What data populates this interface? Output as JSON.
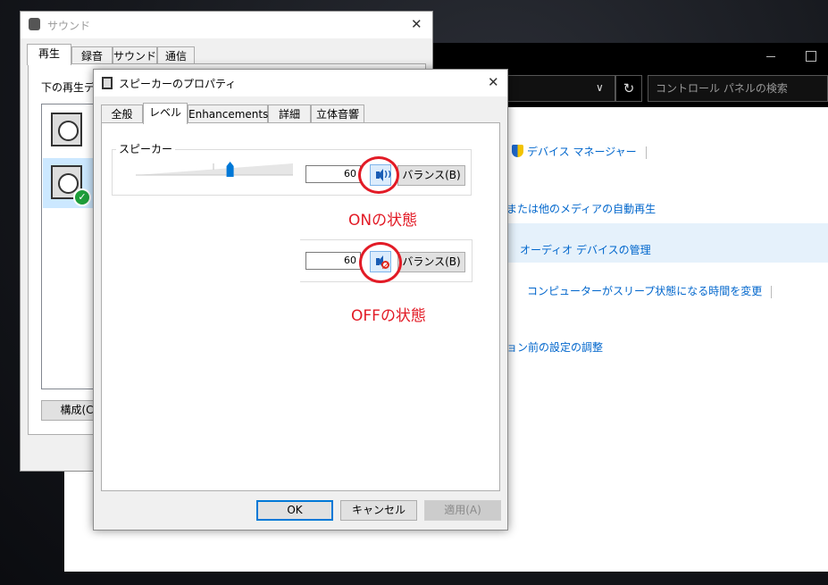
{
  "control_panel": {
    "search_placeholder": "コントロール パネルの検索",
    "links": {
      "device_manager": "デバイス マネージャー",
      "autoplay": "または他のメディアの自動再生",
      "audio_devices": "オーディオ デバイスの管理",
      "sleep": "コンピューターがスリープ状態になる時間を変更",
      "presentation": "ョン前の設定の調整"
    }
  },
  "sound_dialog": {
    "title": "サウンド",
    "tabs": [
      "再生",
      "録音",
      "サウンド",
      "通信"
    ],
    "selected_tab": "再生",
    "list_label": "下の再生デバ",
    "configure_button": "構成(C"
  },
  "properties_dialog": {
    "title": "スピーカーのプロパティ",
    "tabs": [
      "全般",
      "レベル",
      "Enhancements",
      "詳細",
      "立体音響"
    ],
    "selected_tab": "レベル",
    "group_label": "スピーカー",
    "volume": 60,
    "volume_text": "60",
    "balance_button": "バランス(B)",
    "ok_button": "OK",
    "cancel_button": "キャンセル",
    "apply_button": "適用(A)"
  },
  "annotations": {
    "on_state": "ONの状態",
    "off_state": "OFFの状態",
    "color": "#e21b26"
  }
}
